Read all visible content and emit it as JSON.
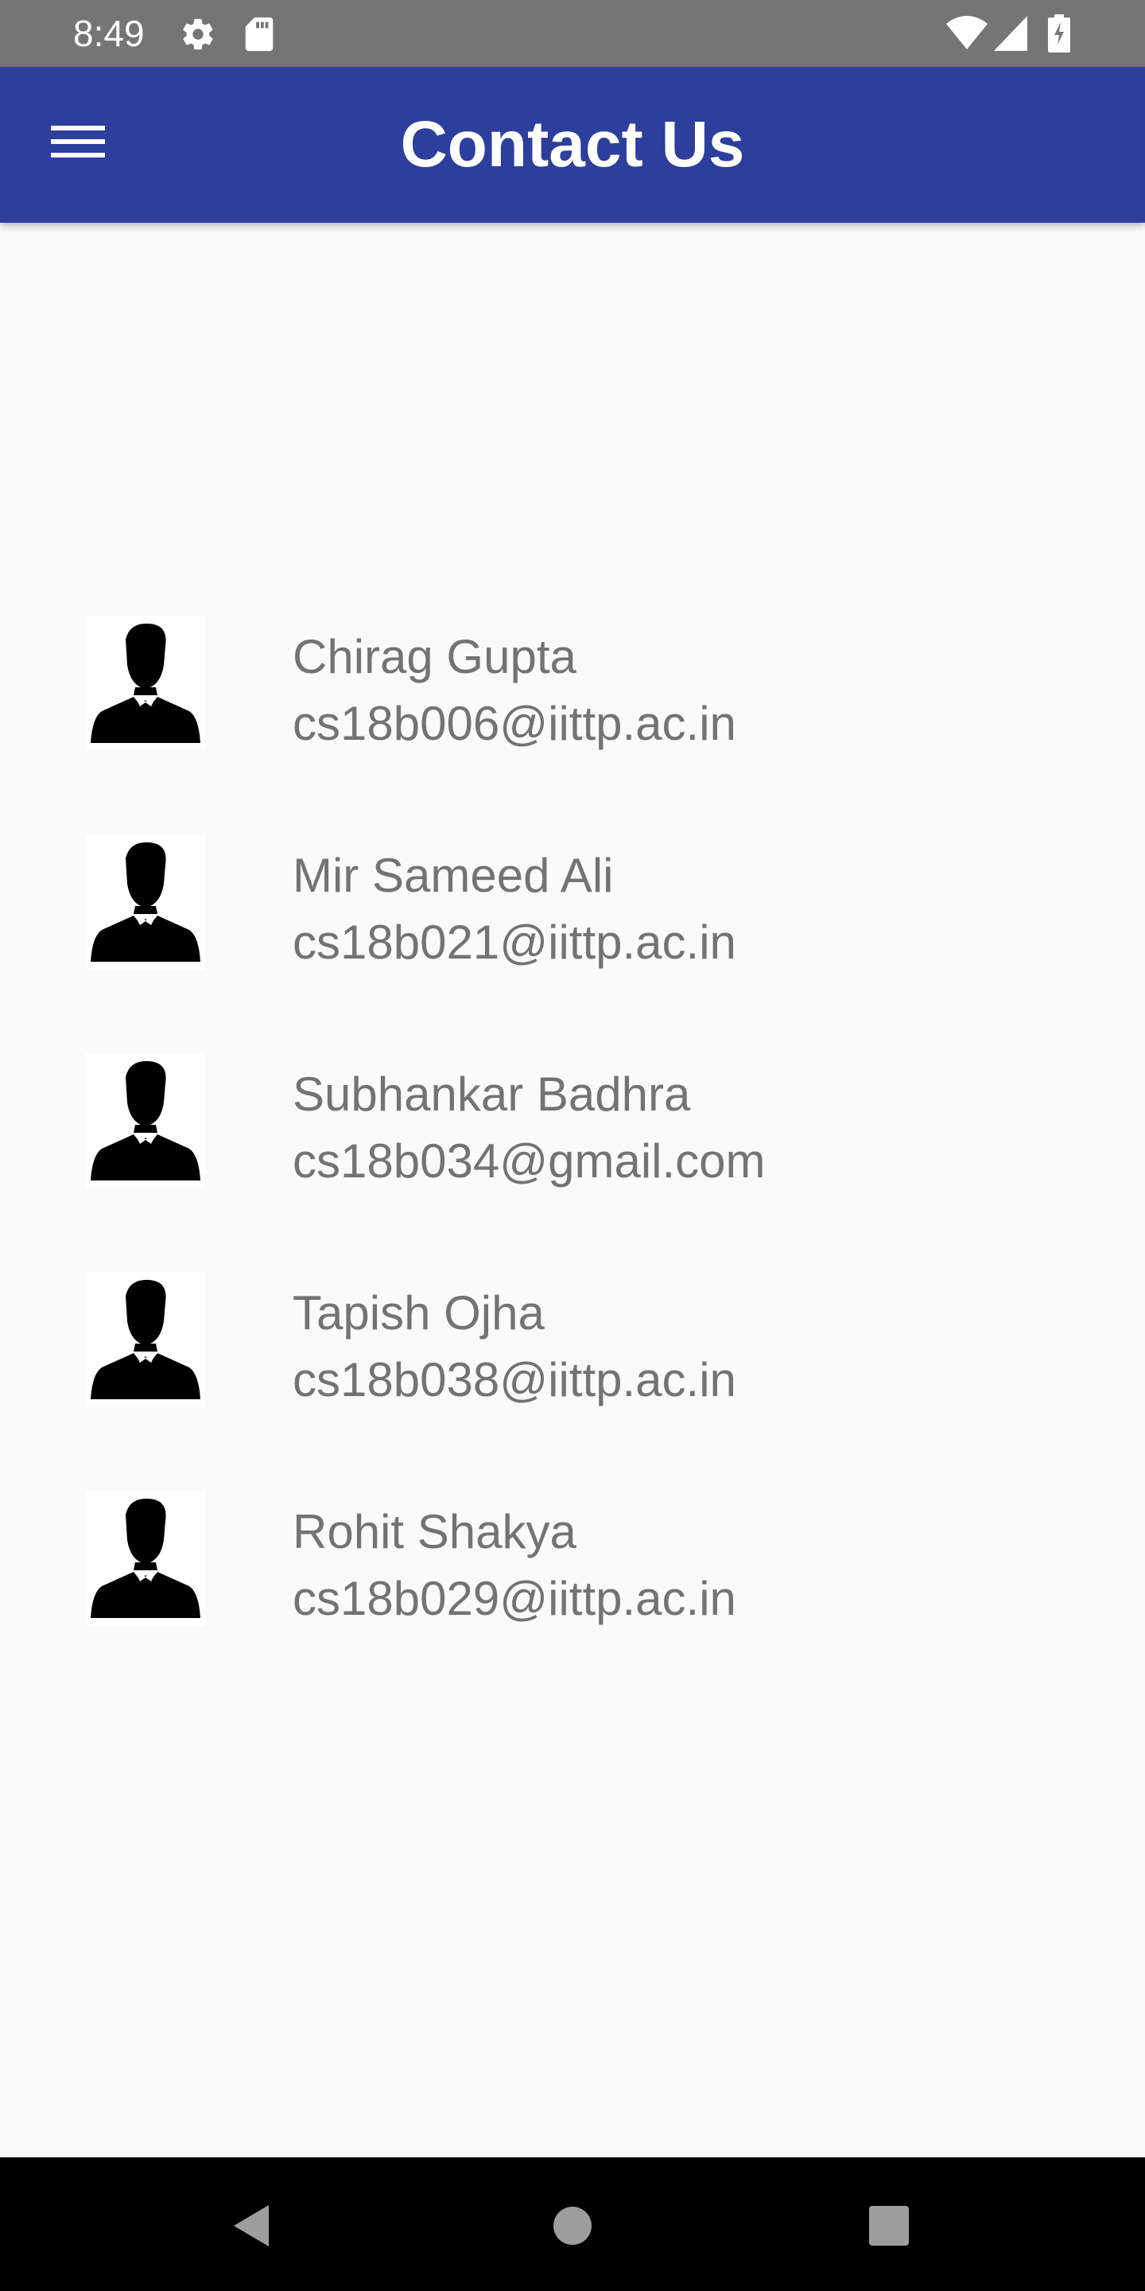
{
  "status_bar": {
    "time": "8:49",
    "icons_left": [
      "gear-icon",
      "sd-card-icon"
    ],
    "icons_right": [
      "wifi-icon",
      "signal-icon",
      "battery-charging-icon"
    ]
  },
  "app_bar": {
    "title": "Contact Us",
    "menu_icon": "hamburger-menu-icon",
    "background": "#2e3e9c"
  },
  "contacts": [
    {
      "name": "Chirag Gupta",
      "email": "cs18b006@iittp.ac.in",
      "avatar_icon": "person-suit-icon"
    },
    {
      "name": "Mir Sameed Ali",
      "email": "cs18b021@iittp.ac.in",
      "avatar_icon": "person-suit-icon"
    },
    {
      "name": "Subhankar Badhra",
      "email": "cs18b034@gmail.com",
      "avatar_icon": "person-suit-icon"
    },
    {
      "name": "Tapish Ojha",
      "email": "cs18b038@iittp.ac.in",
      "avatar_icon": "person-suit-icon"
    },
    {
      "name": "Rohit Shakya",
      "email": "cs18b029@iittp.ac.in",
      "avatar_icon": "person-suit-icon"
    }
  ],
  "nav_bar": {
    "buttons": [
      "back-icon",
      "home-icon",
      "recents-icon"
    ]
  }
}
